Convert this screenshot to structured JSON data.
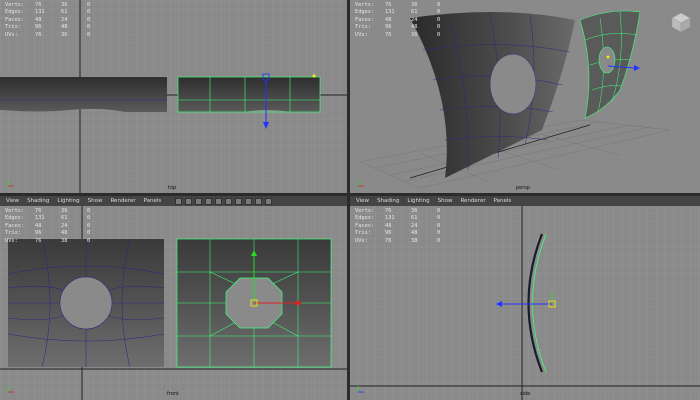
{
  "hud_labels": [
    "Verts:",
    "Edges:",
    "Faces:",
    "Tris:",
    "UVs:"
  ],
  "viewports": {
    "top": {
      "camera": "top",
      "hud": [
        [
          "76",
          "36",
          "0"
        ],
        [
          "131",
          "61",
          "0"
        ],
        [
          "48",
          "24",
          "0"
        ],
        [
          "96",
          "48",
          "0"
        ],
        [
          "76",
          "36",
          "0"
        ]
      ]
    },
    "persp": {
      "camera": "persp",
      "hud": [
        [
          "76",
          "36",
          "0"
        ],
        [
          "131",
          "61",
          "0"
        ],
        [
          "48",
          "24",
          "0"
        ],
        [
          "96",
          "48",
          "0"
        ],
        [
          "76",
          "36",
          "0"
        ]
      ]
    },
    "front": {
      "camera": "front",
      "hud": [
        [
          "76",
          "36",
          "0"
        ],
        [
          "131",
          "61",
          "0"
        ],
        [
          "48",
          "24",
          "0"
        ],
        [
          "96",
          "48",
          "0"
        ],
        [
          "76",
          "38",
          "0"
        ]
      ]
    },
    "side": {
      "camera": "side",
      "hud": [
        [
          "76",
          "36",
          "0"
        ],
        [
          "131",
          "61",
          "0"
        ],
        [
          "48",
          "24",
          "0"
        ],
        [
          "96",
          "48",
          "0"
        ],
        [
          "76",
          "38",
          "0"
        ]
      ]
    }
  },
  "menu": {
    "view": "View",
    "shading": "Shading",
    "lighting": "Lighting",
    "show": "Show",
    "renderer": "Renderer",
    "panels": "Panels"
  },
  "colors": {
    "grid_bg": "#8a8a8a",
    "grid_line": "#9a9a9a",
    "mesh_dark": "#3c3c3c",
    "wire_blue": "#2a2a80",
    "wire_selected": "#3cff78",
    "manip_blue": "#2233ff",
    "manip_yellow": "#ffee00",
    "manip_green": "#22dd22"
  }
}
